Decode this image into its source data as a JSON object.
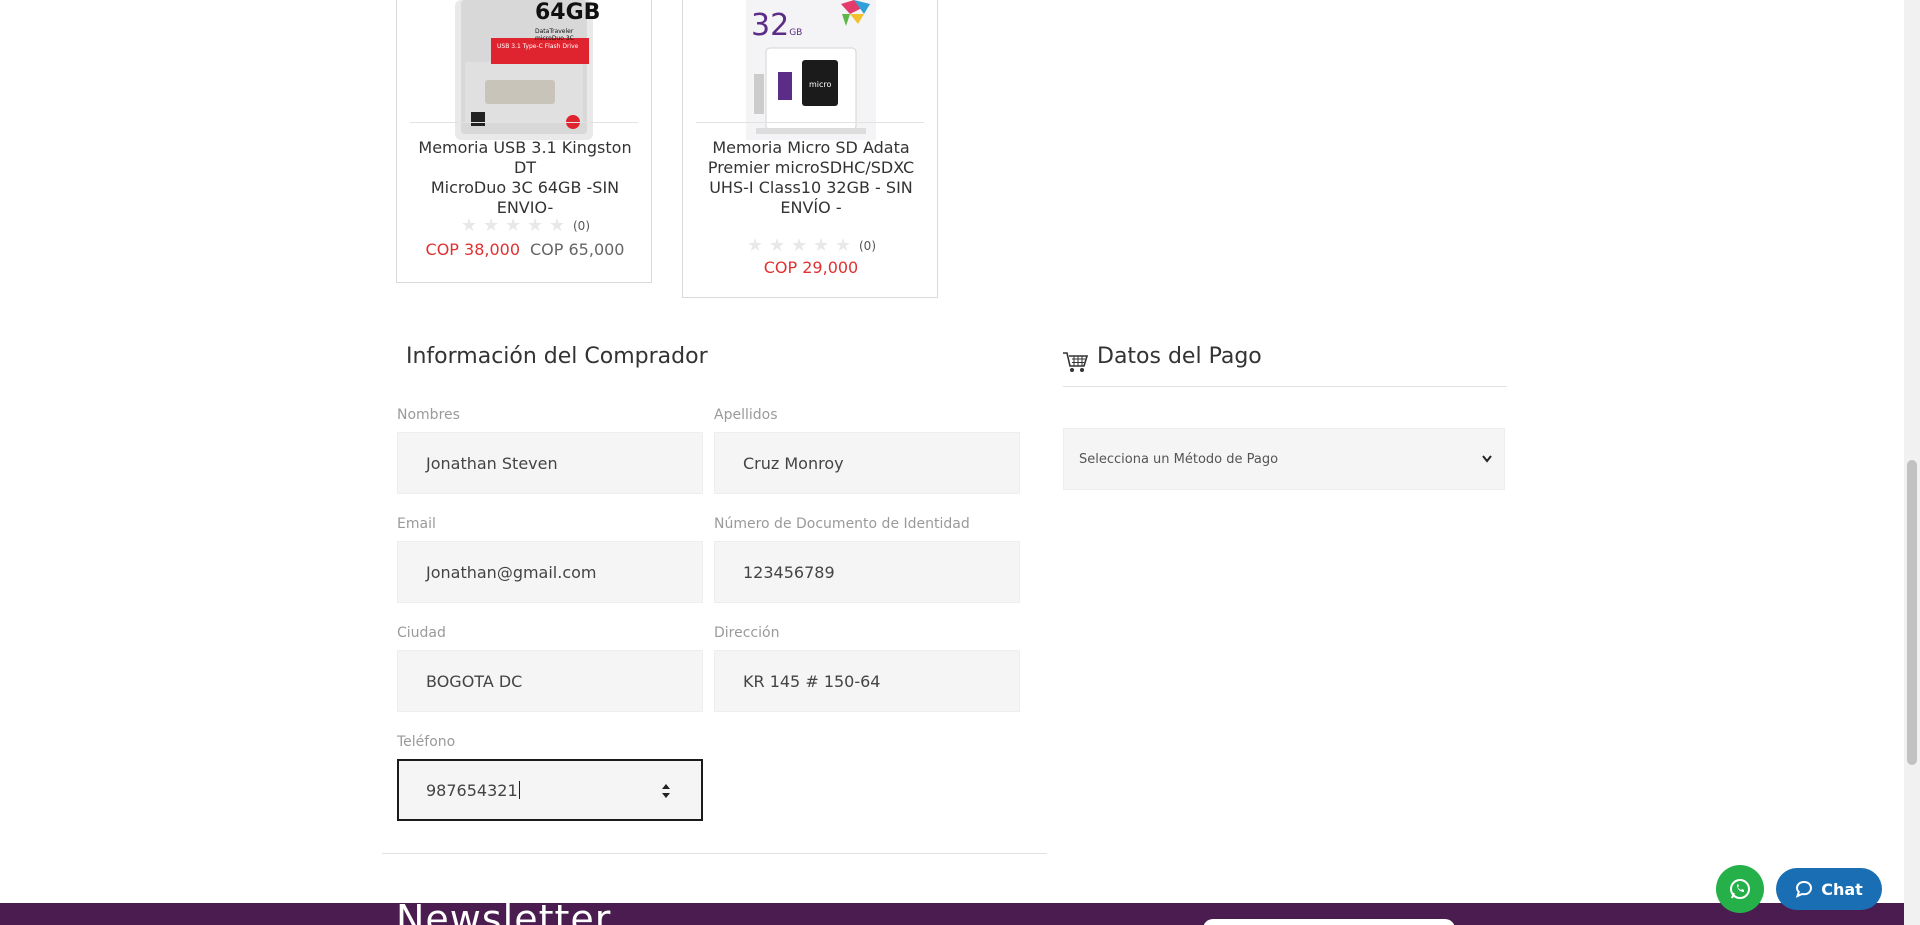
{
  "products": [
    {
      "title": "Memoria USB 3.1 Kingston DT MicroDuo 3C 64GB -SIN ENVIO-",
      "title_lines": [
        "Memoria USB 3.1 Kingston DT",
        "MicroDuo 3C 64GB -SIN",
        "ENVIO-"
      ],
      "image_badge": "64GB",
      "image_sub": "DataTraveler microDuo 3C",
      "image_band": "USB 3.1 Type-C Flash Drive",
      "reviews": "(0)",
      "price_sale": "COP 38,000",
      "price_old": "COP 65,000"
    },
    {
      "title": "Memoria Micro SD Adata Premier microSDHC/SDXC UHS-I Class10 32GB - SIN ENVÍO -",
      "title_lines": [
        "Memoria Micro SD Adata",
        "Premier microSDHC/SDXC",
        "UHS-I Class10 32GB - SIN",
        "ENVÍO -"
      ],
      "image_badge": "32",
      "image_badge_unit": "GB",
      "image_card_text": "micro",
      "reviews": "(0)",
      "price_sale": "COP 29,000"
    }
  ],
  "buyer": {
    "title": "Información del Comprador",
    "fields": {
      "nombres": {
        "label": "Nombres",
        "value": "Jonathan Steven"
      },
      "apellidos": {
        "label": "Apellidos",
        "value": "Cruz Monroy"
      },
      "email": {
        "label": "Email",
        "value": "Jonathan@gmail.com"
      },
      "documento": {
        "label": "Número de Documento de Identidad",
        "value": "123456789"
      },
      "ciudad": {
        "label": "Ciudad",
        "value": "BOGOTA DC"
      },
      "direccion": {
        "label": "Dirección",
        "value": "KR 145 # 150-64"
      },
      "telefono": {
        "label": "Teléfono",
        "value": "987654321"
      }
    }
  },
  "payment": {
    "title": "Datos del Pago",
    "select_placeholder": "Selecciona un Método de Pago"
  },
  "footer": {
    "newsletter": "Newsletter"
  },
  "widgets": {
    "chat_label": "Chat"
  },
  "colors": {
    "sale": "#e03131",
    "footer": "#4a1c4f",
    "whatsapp": "#25b04a",
    "chat": "#1a6fb4"
  }
}
